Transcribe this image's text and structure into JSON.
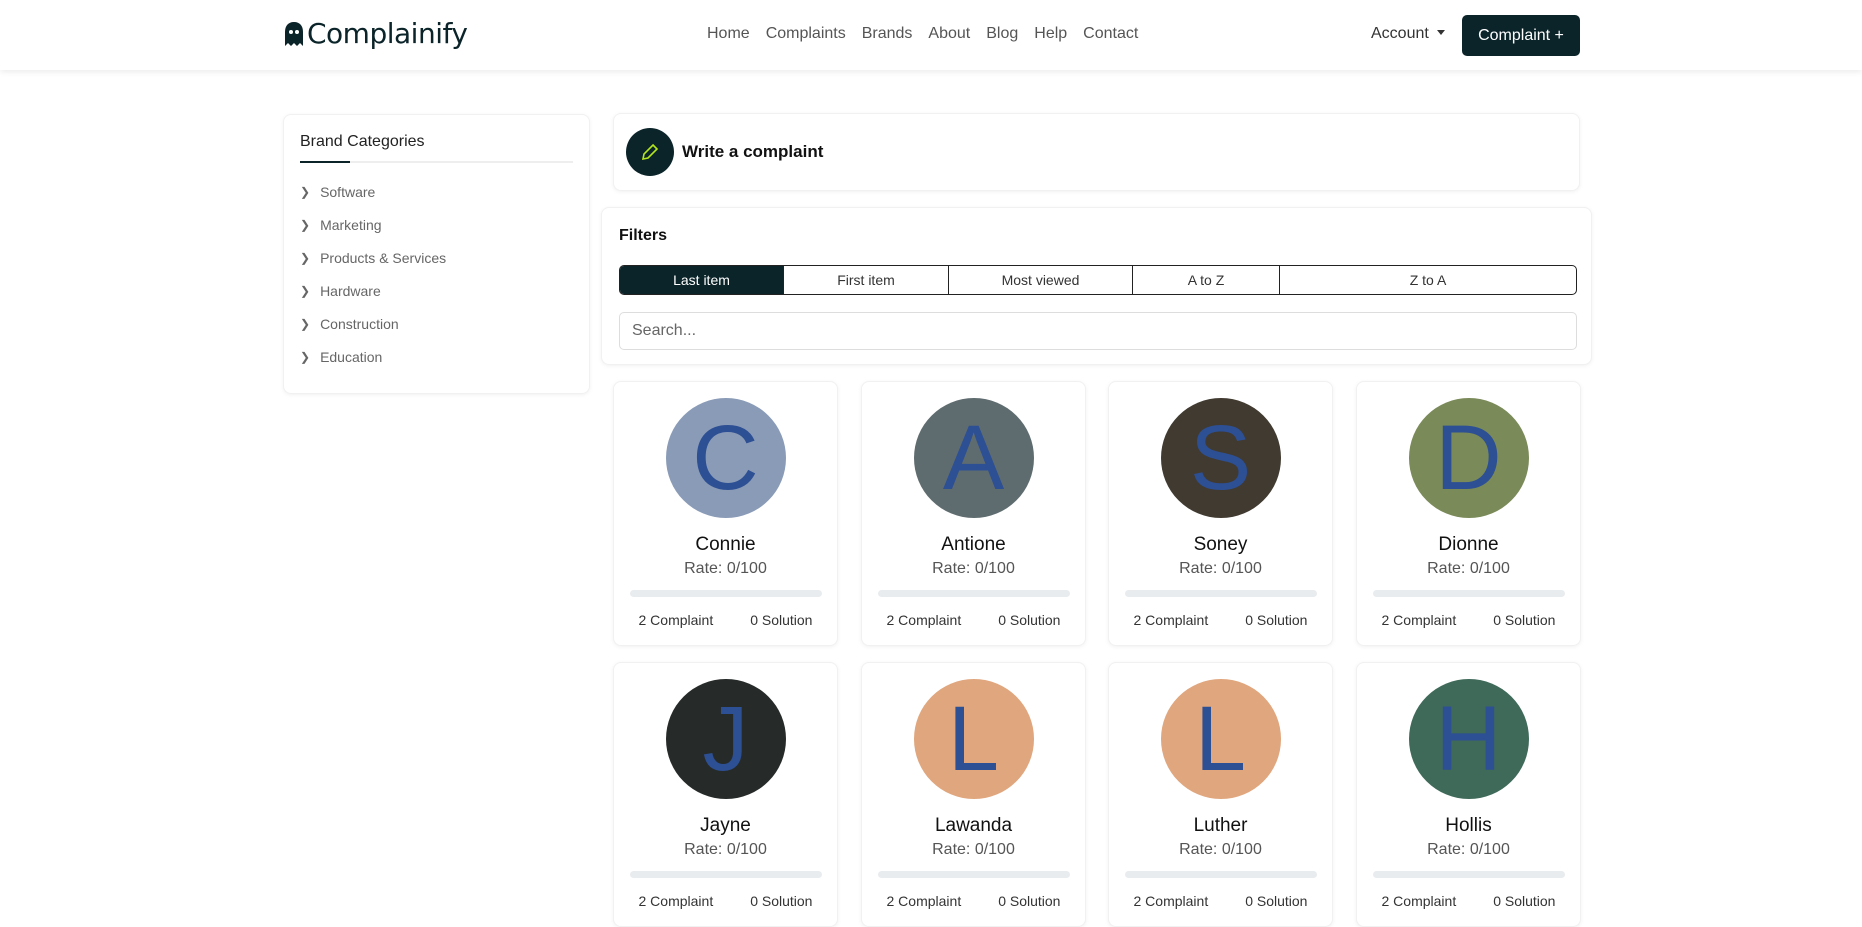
{
  "header": {
    "logo": "Complainify",
    "nav": [
      "Home",
      "Complaints",
      "Brands",
      "About",
      "Blog",
      "Help",
      "Contact"
    ],
    "account": "Account",
    "complaint_button": "Complaint +"
  },
  "sidebar": {
    "title": "Brand Categories",
    "items": [
      "Software",
      "Marketing",
      "Products & Services",
      "Hardware",
      "Construction",
      "Education"
    ]
  },
  "write": {
    "label": "Write a complaint"
  },
  "filters": {
    "title": "Filters",
    "tabs": [
      "Last item",
      "First item",
      "Most viewed",
      "A to Z",
      "Z to A"
    ],
    "active": "Last item",
    "search_placeholder": "Search..."
  },
  "brands": [
    {
      "initial": "C",
      "name": "Connie",
      "rate": "Rate: 0/100",
      "rate_value": 0,
      "complaints": "2 Complaint",
      "solutions": "0 Solution",
      "color": "#8a9bb7"
    },
    {
      "initial": "A",
      "name": "Antione",
      "rate": "Rate: 0/100",
      "rate_value": 0,
      "complaints": "2 Complaint",
      "solutions": "0 Solution",
      "color": "#5f6c6f"
    },
    {
      "initial": "S",
      "name": "Soney",
      "rate": "Rate: 0/100",
      "rate_value": 0,
      "complaints": "2 Complaint",
      "solutions": "0 Solution",
      "color": "#403a30"
    },
    {
      "initial": "D",
      "name": "Dionne",
      "rate": "Rate: 0/100",
      "rate_value": 0,
      "complaints": "2 Complaint",
      "solutions": "0 Solution",
      "color": "#7a8a58"
    },
    {
      "initial": "J",
      "name": "Jayne",
      "rate": "Rate: 0/100",
      "rate_value": 0,
      "complaints": "2 Complaint",
      "solutions": "0 Solution",
      "color": "#262b2a"
    },
    {
      "initial": "L",
      "name": "Lawanda",
      "rate": "Rate: 0/100",
      "rate_value": 0,
      "complaints": "2 Complaint",
      "solutions": "0 Solution",
      "color": "#e0a67d"
    },
    {
      "initial": "L",
      "name": "Luther",
      "rate": "Rate: 0/100",
      "rate_value": 0,
      "complaints": "2 Complaint",
      "solutions": "0 Solution",
      "color": "#e0a67d"
    },
    {
      "initial": "H",
      "name": "Hollis",
      "rate": "Rate: 0/100",
      "rate_value": 0,
      "complaints": "2 Complaint",
      "solutions": "0 Solution",
      "color": "#3f6a5a"
    }
  ]
}
